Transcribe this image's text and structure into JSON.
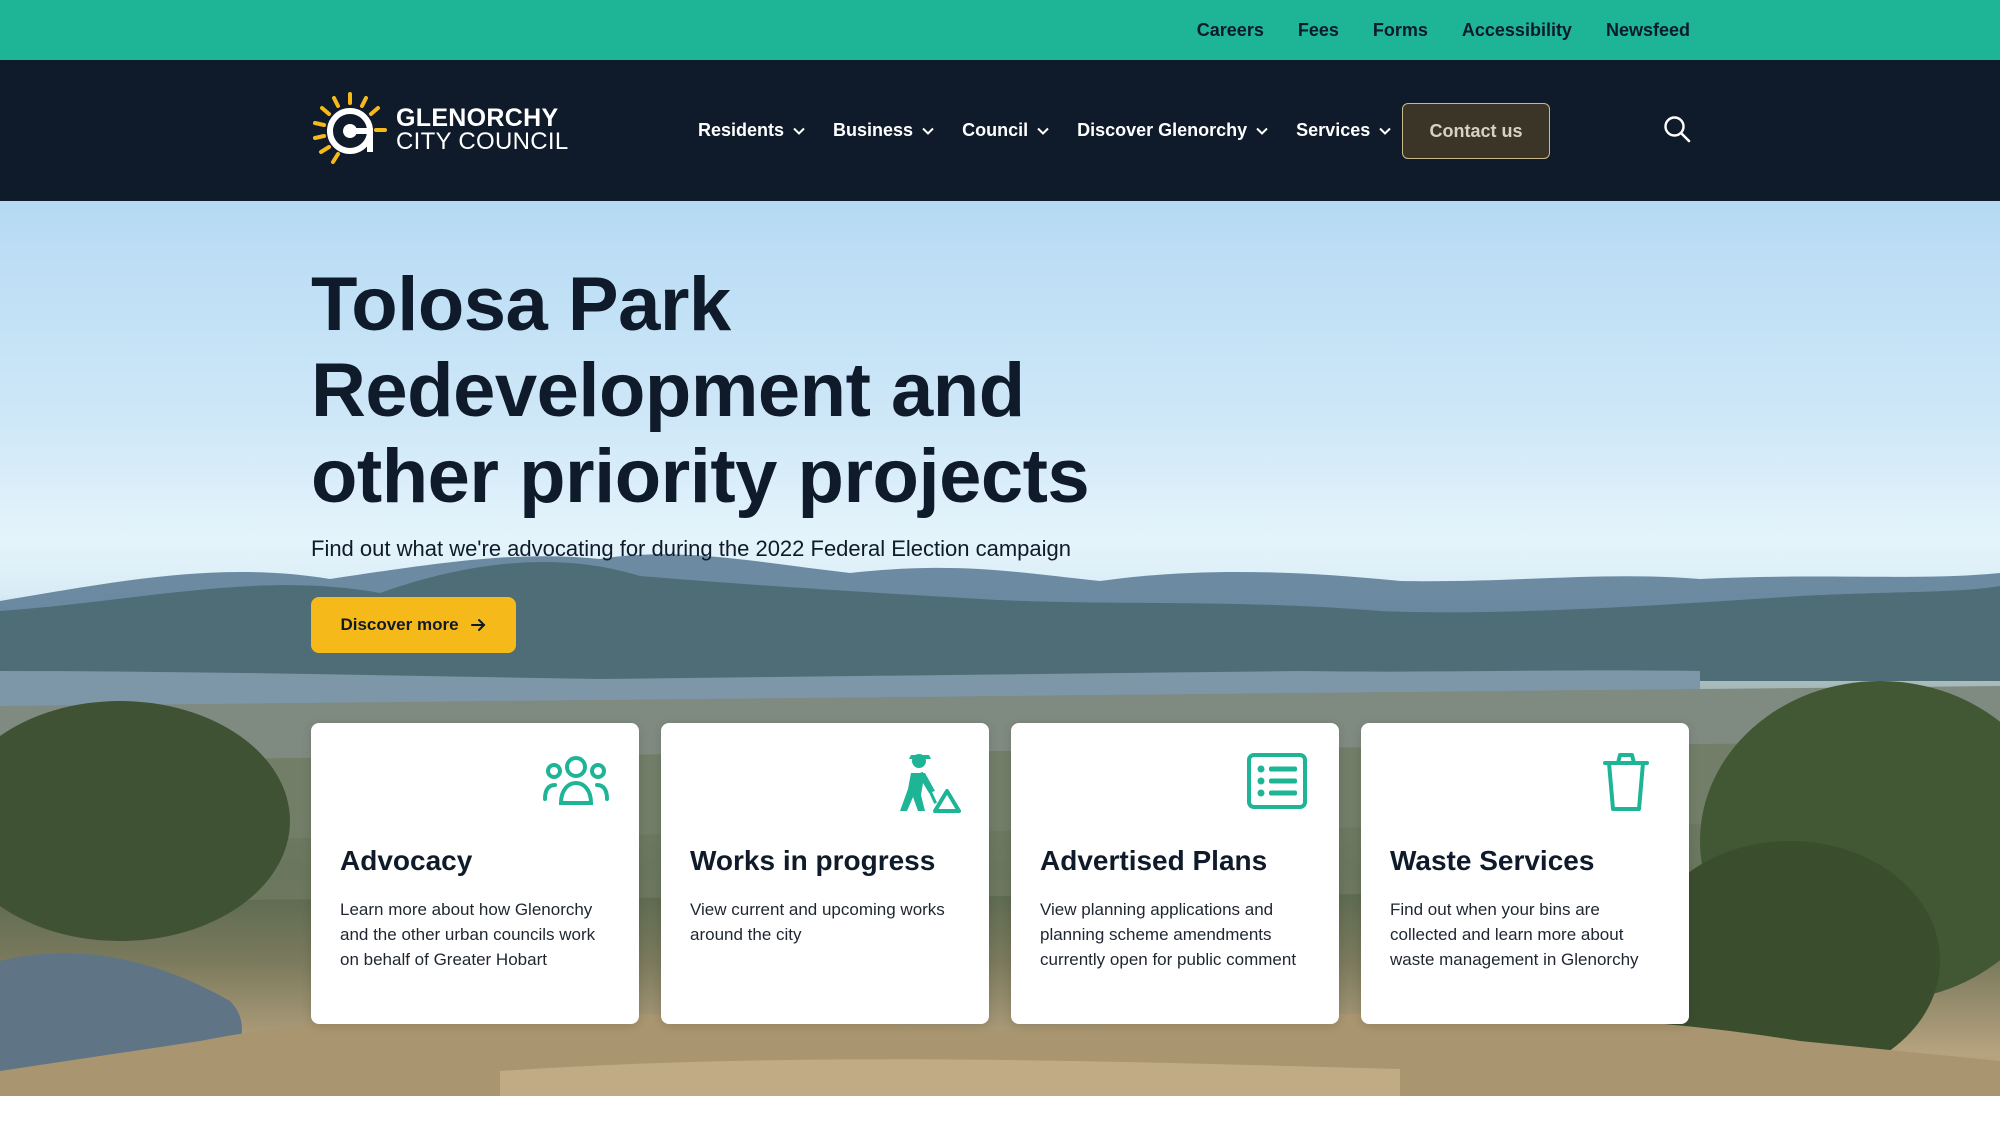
{
  "utility": {
    "links": [
      "Careers",
      "Fees",
      "Forms",
      "Accessibility",
      "Newsfeed"
    ]
  },
  "header": {
    "logo_line1": "GLENORCHY",
    "logo_line2": "CITY COUNCIL",
    "nav": [
      "Residents",
      "Business",
      "Council",
      "Discover Glenorchy",
      "Services"
    ],
    "contact_label": "Contact us",
    "search_icon": "search-icon"
  },
  "hero": {
    "title": "Tolosa Park Redevelopment and other priority projects",
    "subtitle": "Find out what we're advocating for during the 2022 Federal Election campaign",
    "cta_label": "Discover more"
  },
  "cards": [
    {
      "title": "Advocacy",
      "description": "Learn more about how Glenorchy and the other urban councils work on behalf of Greater Hobart",
      "icon": "people-group-icon"
    },
    {
      "title": "Works in progress",
      "description": "View current and upcoming works around the city",
      "icon": "construction-worker-icon"
    },
    {
      "title": "Advertised Plans",
      "description": "View planning applications and planning scheme amendments currently open for public comment",
      "icon": "list-document-icon"
    },
    {
      "title": "Waste Services",
      "description": "Find out when your bins are collected and learn more about waste management in Glenorchy",
      "icon": "bin-icon"
    }
  ],
  "colors": {
    "utility_bar": "#1db596",
    "header_bg": "#0f1b2a",
    "accent_yellow": "#f6b91a",
    "icon_teal": "#1db596"
  }
}
